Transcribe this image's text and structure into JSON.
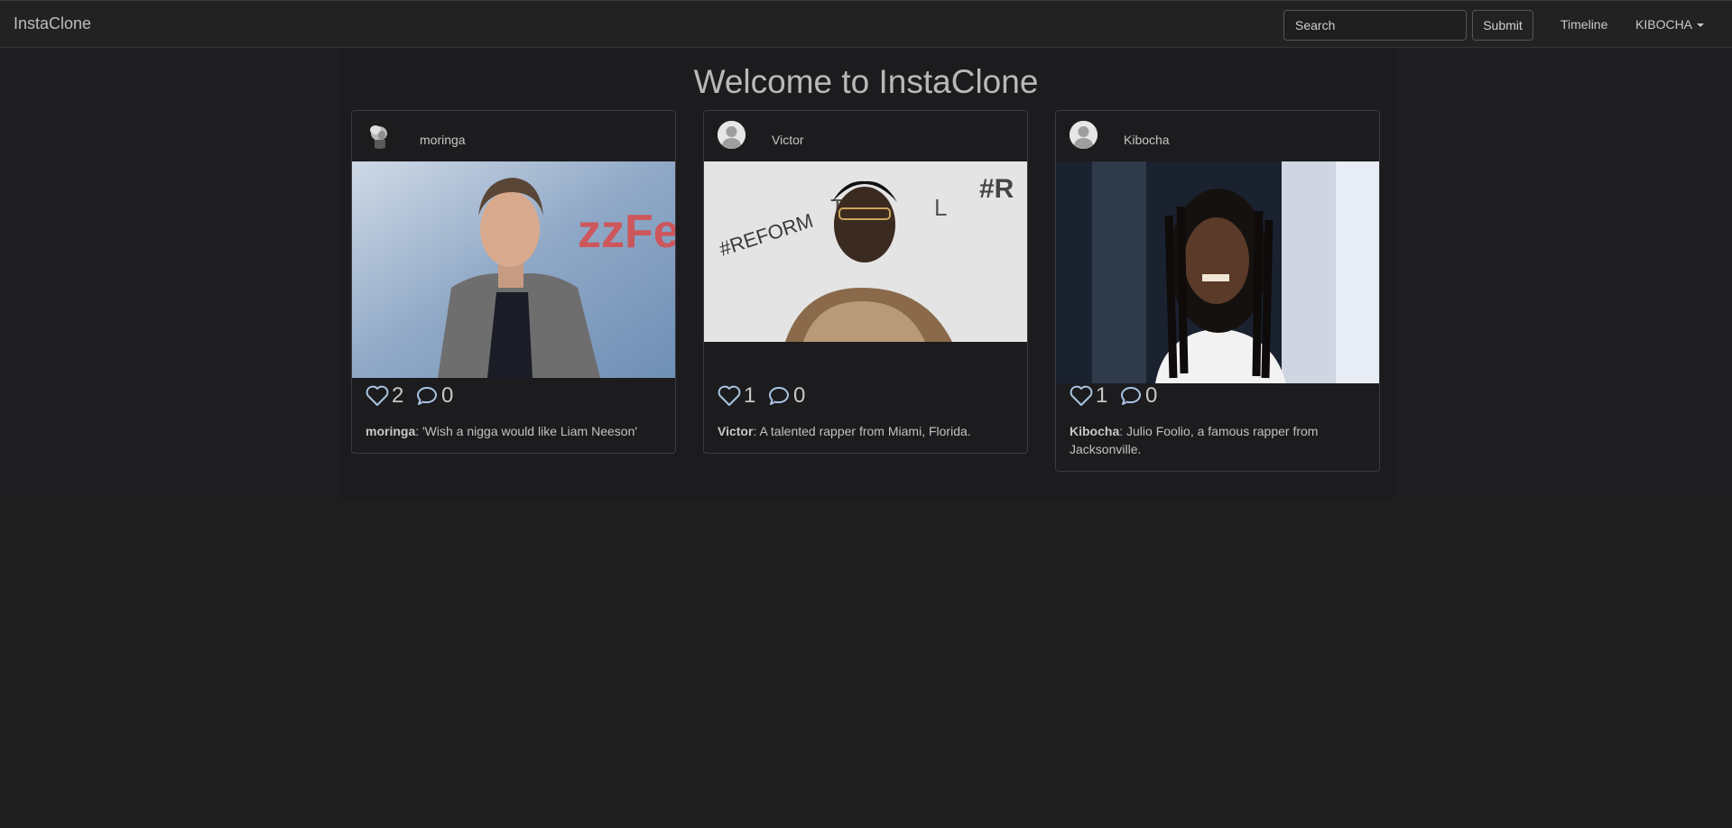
{
  "navbar": {
    "brand": "InstaClone",
    "search_placeholder": "Search",
    "submit_label": "Submit",
    "timeline_label": "Timeline",
    "user_menu_label": "KIBOCHA"
  },
  "page": {
    "title": "Welcome to InstaClone"
  },
  "posts": [
    {
      "username": "moringa",
      "likes": "2",
      "comments": "0",
      "author": "moringa",
      "caption": ": 'Wish a nigga would like Liam Neeson'"
    },
    {
      "username": "Victor",
      "likes": "1",
      "comments": "0",
      "author": "Victor",
      "caption": ": A talented rapper from Miami, Florida."
    },
    {
      "username": "Kibocha",
      "likes": "1",
      "comments": "0",
      "author": "Kibocha",
      "caption": ": Julio Foolio, a famous rapper from Jacksonville."
    }
  ],
  "icons": {
    "like": "heart-icon",
    "comment": "comment-icon",
    "dropdown": "caret-down-icon"
  },
  "colors": {
    "background": "#1f1f1f",
    "navbar": "#222222",
    "icon_accent": "#a9c4e0"
  }
}
